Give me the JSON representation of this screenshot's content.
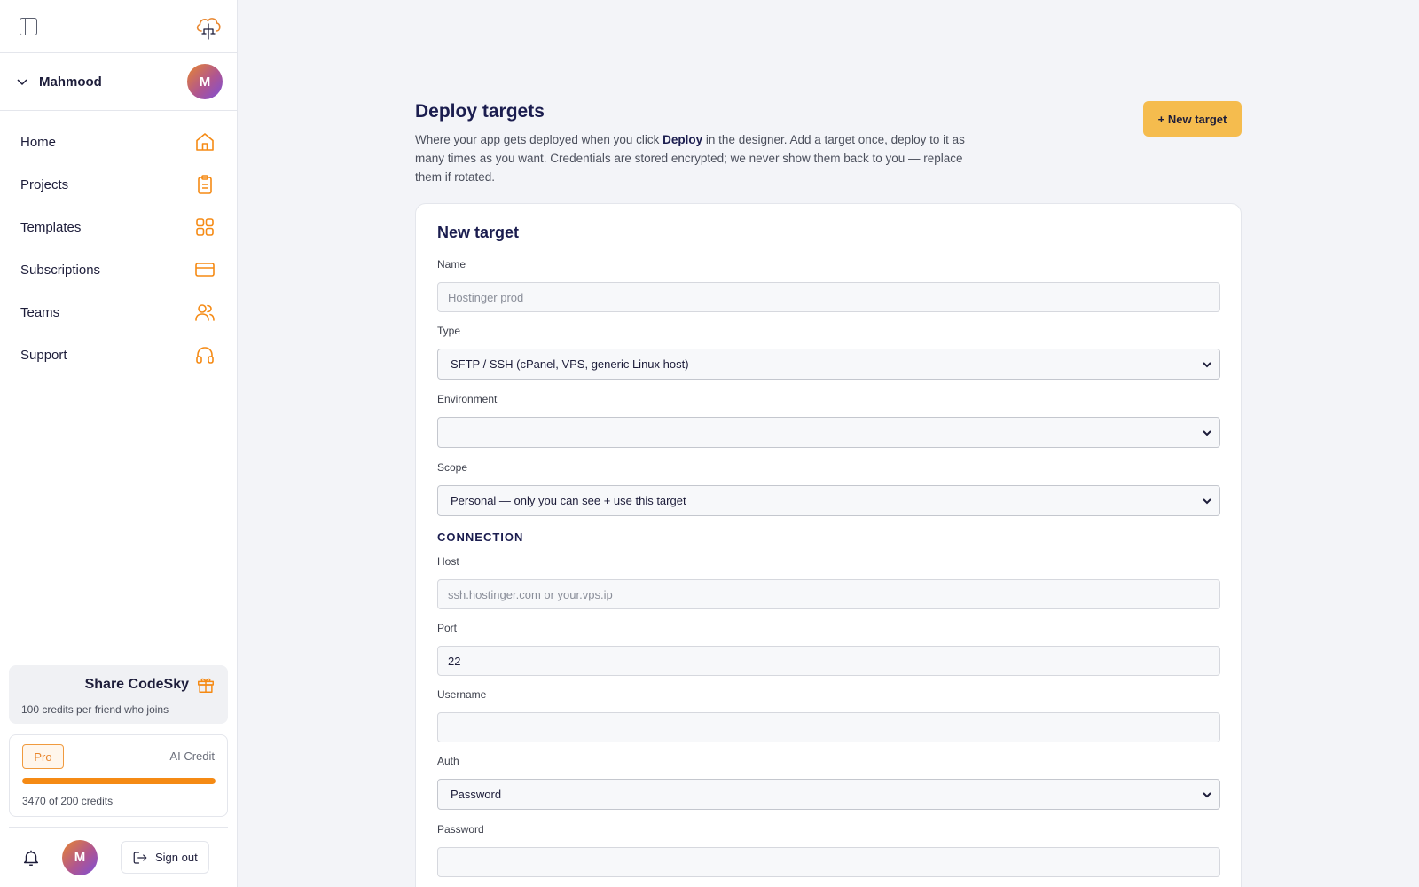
{
  "sidebar": {
    "user": {
      "name": "Mahmood",
      "initial": "M"
    },
    "items": [
      {
        "label": "Home",
        "icon": "home-icon"
      },
      {
        "label": "Projects",
        "icon": "clipboard-icon"
      },
      {
        "label": "Templates",
        "icon": "grid-icon"
      },
      {
        "label": "Subscriptions",
        "icon": "credit-card-icon"
      },
      {
        "label": "Teams",
        "icon": "users-icon"
      },
      {
        "label": "Support",
        "icon": "headphones-icon"
      }
    ],
    "share": {
      "title": "Share CodeSky",
      "subtitle": "100 credits per friend who joins"
    },
    "credits": {
      "plan": "Pro",
      "label": "AI Credit",
      "text": "3470 of 200 credits",
      "fill_fraction": 1.0
    },
    "footer": {
      "avatar_initial": "M",
      "signout_label": "Sign out"
    }
  },
  "header": {
    "title": "Deploy targets",
    "desc_before": "Where your app gets deployed when you click ",
    "desc_bold": "Deploy",
    "desc_after": " in the designer. Add a target once, deploy to it as many times as you want. Credentials are stored encrypted; we never show them back to you — replace them if rotated.",
    "new_target_label": "+ New target"
  },
  "form": {
    "title": "New target",
    "name": {
      "label": "Name",
      "placeholder": "Hostinger prod",
      "value": ""
    },
    "type": {
      "label": "Type",
      "value": "SFTP / SSH (cPanel, VPS, generic Linux host)"
    },
    "environment": {
      "label": "Environment",
      "value": ""
    },
    "scope": {
      "label": "Scope",
      "value": "Personal — only you can see + use this target"
    },
    "connection_heading": "CONNECTION",
    "host": {
      "label": "Host",
      "placeholder": "ssh.hostinger.com or your.vps.ip",
      "value": ""
    },
    "port": {
      "label": "Port",
      "value": "22"
    },
    "username": {
      "label": "Username",
      "value": ""
    },
    "auth": {
      "label": "Auth",
      "value": "Password"
    },
    "password": {
      "label": "Password",
      "value": ""
    }
  },
  "colors": {
    "accent": "#f58a14",
    "button": "#f5bc4e",
    "heading": "#1b1d4f"
  }
}
